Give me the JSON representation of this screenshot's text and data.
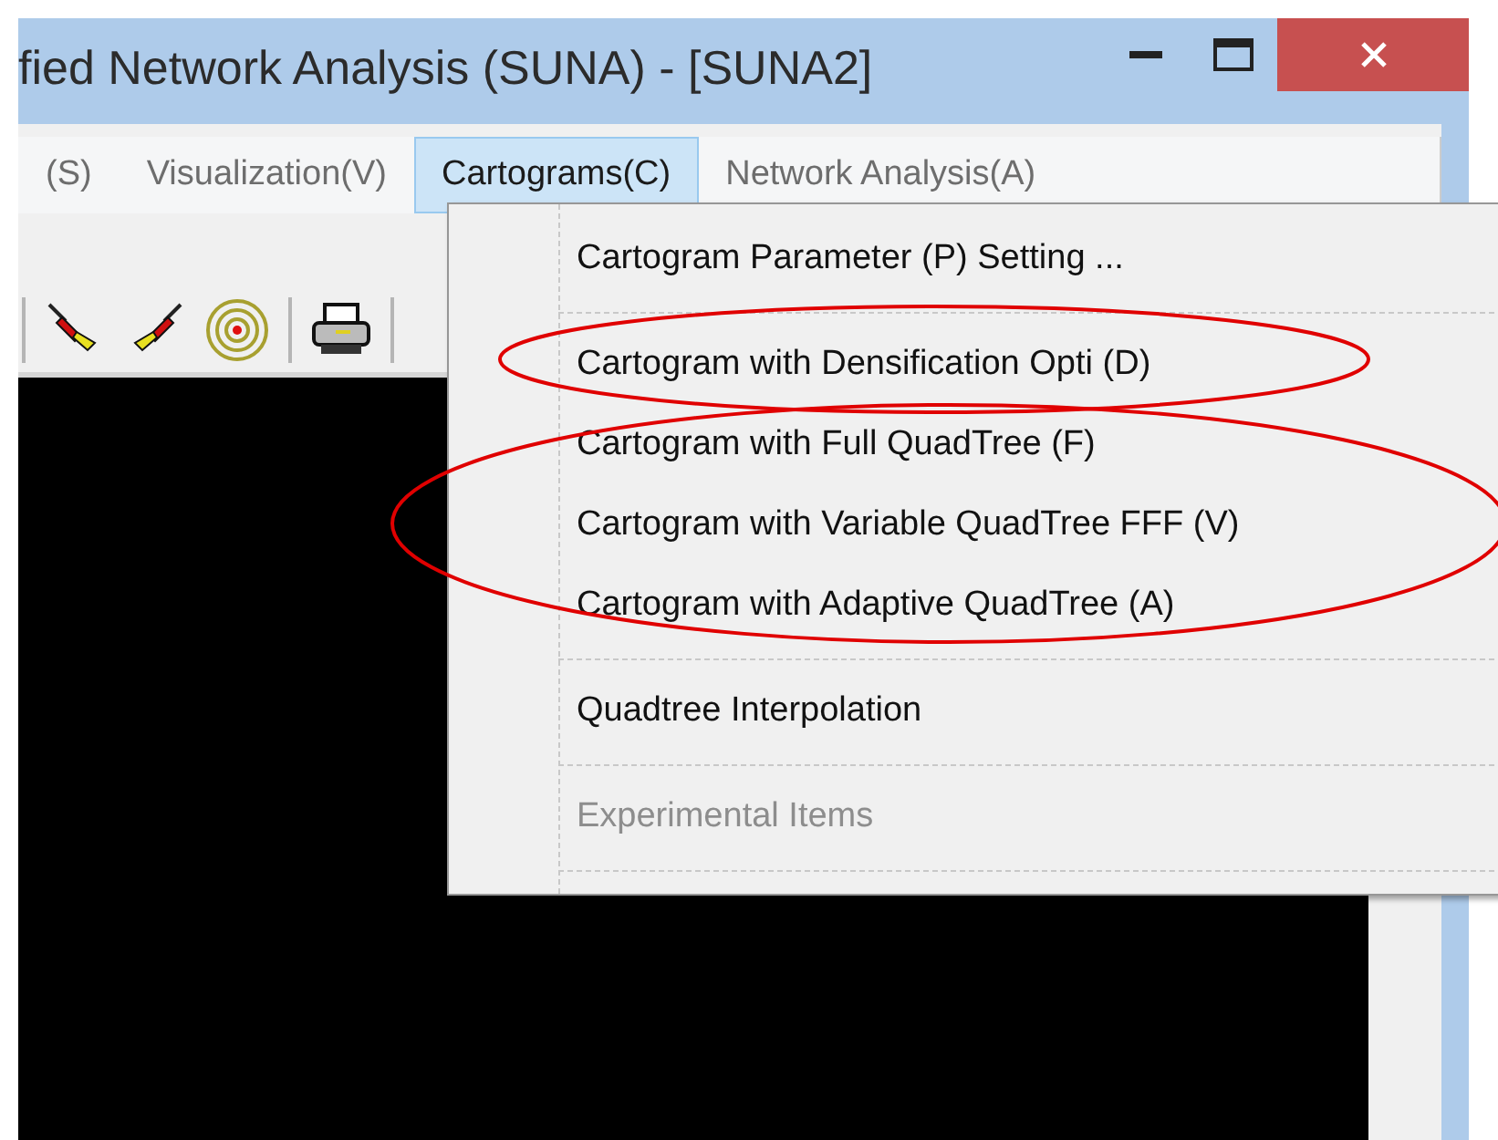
{
  "window": {
    "title": "fied Network Analysis (SUNA) - [SUNA2]",
    "controls": [
      {
        "kind": "minimize"
      },
      {
        "kind": "maximize"
      },
      {
        "kind": "close"
      }
    ]
  },
  "menu_bar": [
    {
      "label": "(S)",
      "selected": false
    },
    {
      "label": "Visualization(V)",
      "selected": false
    },
    {
      "label": "Cartograms(C)",
      "selected": true
    },
    {
      "label": "Network Analysis(A)",
      "selected": false
    }
  ],
  "dropdown": [
    {
      "kind": "item",
      "label": "Cartogram Parameter (P) Setting ...",
      "disabled": false
    },
    {
      "kind": "separator"
    },
    {
      "kind": "item",
      "label": "Cartogram with Densification Opti (D)",
      "disabled": false
    },
    {
      "kind": "item",
      "label": "Cartogram with Full QuadTree (F)",
      "disabled": false
    },
    {
      "kind": "item",
      "label": "Cartogram with Variable QuadTree FFF (V)",
      "disabled": false
    },
    {
      "kind": "item",
      "label": "Cartogram with Adaptive QuadTree (A)",
      "disabled": false
    },
    {
      "kind": "separator"
    },
    {
      "kind": "item",
      "label": "Quadtree Interpolation",
      "disabled": false
    },
    {
      "kind": "separator"
    },
    {
      "kind": "item",
      "label": "Experimental Items",
      "disabled": true
    },
    {
      "kind": "separator"
    }
  ]
}
